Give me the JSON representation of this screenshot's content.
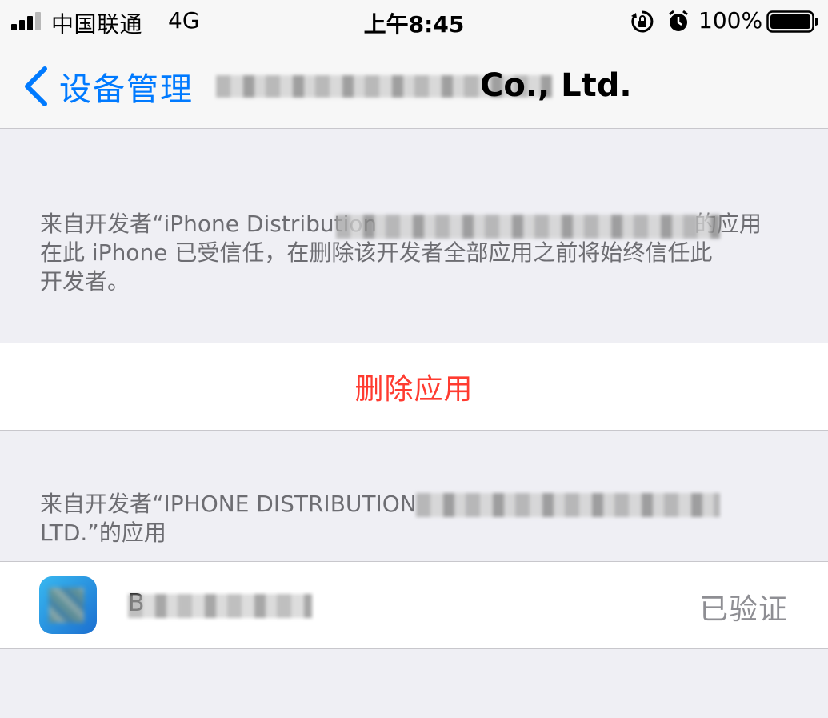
{
  "status_bar": {
    "carrier": "中国联通",
    "network": "4G",
    "time": "上午8:45",
    "battery_percent": "100%",
    "icons": [
      "signal-icon",
      "orientation-lock-icon",
      "alarm-icon",
      "battery-icon"
    ]
  },
  "nav": {
    "back_label": "设备管理",
    "title_visible": "Co., Ltd."
  },
  "trust_section": {
    "line1_start": "来自开发者“iPhone Distribution",
    "line1_end": "的应用",
    "line2": "在此 iPhone 已受信任，在删除该开发者全部应用之前将始终信任此",
    "line3": "开发者。"
  },
  "actions": {
    "delete_label": "删除应用"
  },
  "apps_section": {
    "header_start": "来自开发者“IPHONE DISTRIBUTION",
    "header_line2": "LTD.”的应用",
    "apps": [
      {
        "name_initial": "B",
        "status": "已验证"
      }
    ]
  },
  "colors": {
    "tint": "#007aff",
    "destructive": "#ff3b30",
    "background": "#efeff4",
    "secondary_text": "#6d6d72"
  }
}
